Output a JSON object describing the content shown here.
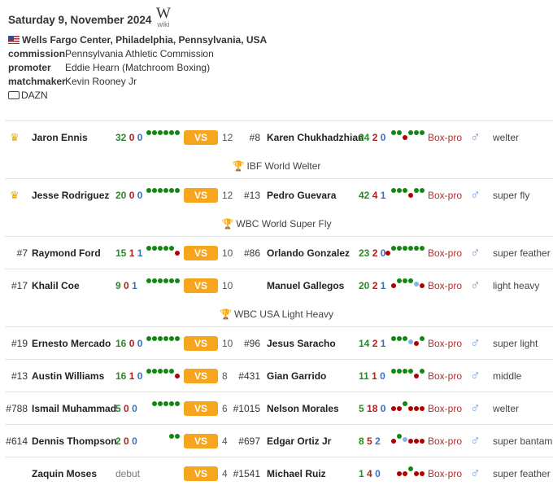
{
  "event": {
    "date": "Saturday 9, November 2024",
    "wiki_label": "wiki",
    "wiki_logo": "W",
    "venue": "Wells Fargo Center, Philadelphia, Pennsylvania, USA",
    "flag_icon": "us-flag-icon",
    "commission_label": "commission",
    "commission": "Pennsylvania Athletic Commission",
    "promoter_label": "promoter",
    "promoter": "Eddie Hearn (Matchroom Boxing)",
    "matchmaker_label": "matchmaker",
    "matchmaker": "Kevin Rooney Jr",
    "broadcaster": "DAZN"
  },
  "colors": {
    "win": "#2a8a2a",
    "loss": "#b02020",
    "draw": "#3a6fc0",
    "vs": "#f7a51c",
    "form_win": "#118811",
    "form_loss": "#b00000",
    "form_draw": "#88b0e8"
  },
  "vs_label": "VS",
  "sport_label": "Box-pro",
  "gender_icon": "male-icon",
  "bouts": [
    {
      "champ": true,
      "rank_a": "",
      "name_a": "Jaron Ennis",
      "rec_a": [
        "32",
        "0",
        "0"
      ],
      "form_a": "WWWWWW",
      "rounds": "12",
      "rank_b": "#8",
      "name_b": "Karen Chukhadzhian",
      "rec_b": [
        "24",
        "2",
        "0"
      ],
      "form_b": "WWLWWW",
      "weight": "welter",
      "title": "IBF World Welter"
    },
    {
      "champ": true,
      "rank_a": "",
      "name_a": "Jesse Rodriguez",
      "rec_a": [
        "20",
        "0",
        "0"
      ],
      "form_a": "WWWWWW",
      "rounds": "12",
      "rank_b": "#13",
      "name_b": "Pedro Guevara",
      "rec_b": [
        "42",
        "4",
        "1"
      ],
      "form_b": "WWWLWW",
      "weight": "super fly",
      "title": "WBC World Super Fly"
    },
    {
      "champ": false,
      "rank_a": "#7",
      "name_a": "Raymond Ford",
      "rec_a": [
        "15",
        "1",
        "1"
      ],
      "form_a": "WWWWWL",
      "rounds": "10",
      "rank_b": "#86",
      "name_b": "Orlando Gonzalez",
      "rec_b": [
        "23",
        "2",
        "0"
      ],
      "form_b": "LWWWWWW",
      "weight": "super feather",
      "title": ""
    },
    {
      "champ": false,
      "rank_a": "#17",
      "name_a": "Khalil Coe",
      "rec_a": [
        "9",
        "0",
        "1"
      ],
      "form_a": "WWWWWW",
      "rounds": "10",
      "rank_b": "",
      "name_b": "Manuel Gallegos",
      "rec_b": [
        "20",
        "2",
        "1"
      ],
      "form_b": "LWWWDL",
      "weight": "light heavy",
      "title": "WBC USA Light Heavy"
    },
    {
      "champ": false,
      "rank_a": "#19",
      "name_a": "Ernesto Mercado",
      "rec_a": [
        "16",
        "0",
        "0"
      ],
      "form_a": "WWWWWW",
      "rounds": "10",
      "rank_b": "#96",
      "name_b": "Jesus Saracho",
      "rec_b": [
        "14",
        "2",
        "1"
      ],
      "form_b": "WWWDLW",
      "weight": "super light",
      "title": ""
    },
    {
      "champ": false,
      "rank_a": "#13",
      "name_a": "Austin Williams",
      "rec_a": [
        "16",
        "1",
        "0"
      ],
      "form_a": "WWWWWL",
      "rounds": "8",
      "rank_b": "#431",
      "name_b": "Gian Garrido",
      "rec_b": [
        "11",
        "1",
        "0"
      ],
      "form_b": "WWWWLW",
      "weight": "middle",
      "title": ""
    },
    {
      "champ": false,
      "rank_a": "#788",
      "name_a": "Ismail Muhammad",
      "rec_a": [
        "5",
        "0",
        "0"
      ],
      "form_a": "WWWWW",
      "rounds": "6",
      "rank_b": "#1015",
      "name_b": "Nelson Morales",
      "rec_b": [
        "5",
        "18",
        "0"
      ],
      "form_b": "LLWLLL",
      "weight": "welter",
      "title": ""
    },
    {
      "champ": false,
      "rank_a": "#614",
      "name_a": "Dennis Thompson",
      "rec_a": [
        "2",
        "0",
        "0"
      ],
      "form_a": "WW",
      "rounds": "4",
      "rank_b": "#697",
      "name_b": "Edgar Ortiz Jr",
      "rec_b": [
        "8",
        "5",
        "2"
      ],
      "form_b": "LWDLLL",
      "weight": "super bantam",
      "title": ""
    },
    {
      "champ": false,
      "rank_a": "",
      "name_a": "Zaquin Moses",
      "debut": "debut",
      "rec_a": null,
      "form_a": "",
      "rounds": "4",
      "rank_b": "#1541",
      "name_b": "Michael Ruiz",
      "rec_b": [
        "1",
        "4",
        "0"
      ],
      "form_b": "LLWLL",
      "weight": "super feather",
      "title": ""
    }
  ]
}
